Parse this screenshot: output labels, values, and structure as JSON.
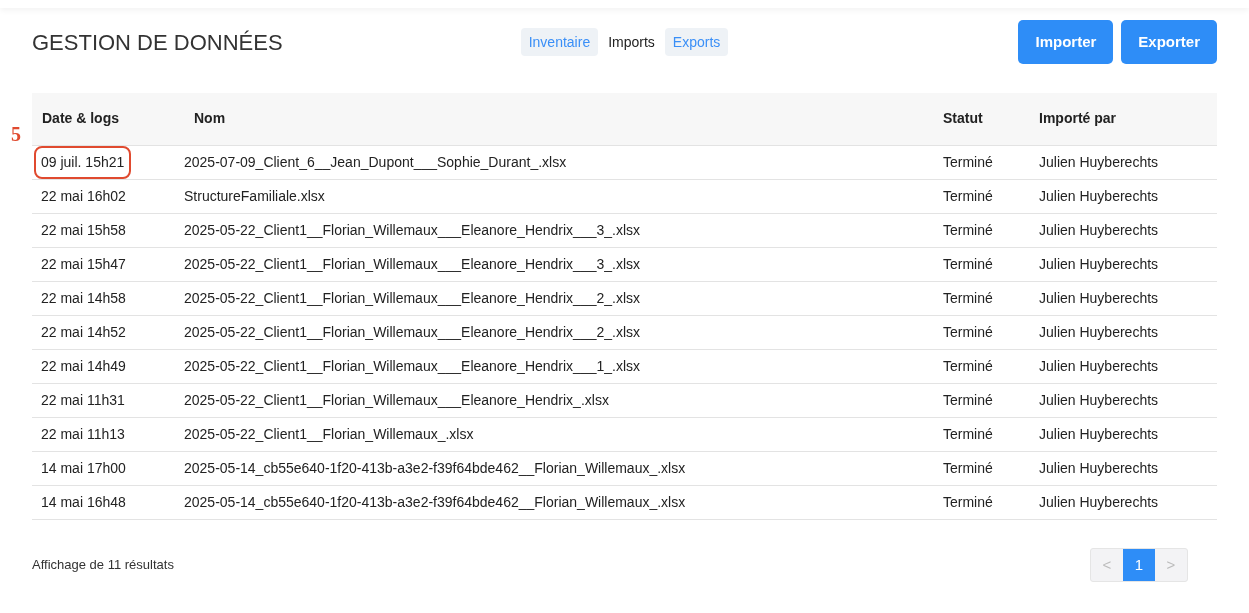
{
  "title": "GESTION DE DONNÉES",
  "tabs": [
    {
      "label": "Inventaire",
      "selected": false
    },
    {
      "label": "Imports",
      "selected": true
    },
    {
      "label": "Exports",
      "selected": false
    }
  ],
  "buttons": [
    "Importer",
    "Exporter"
  ],
  "annotation_label": "5",
  "table": {
    "columns": [
      "Date & logs",
      "Nom",
      "Statut",
      "Importé par"
    ],
    "rows": [
      {
        "date": "09 juil. 15h21",
        "name": "2025-07-09_Client_6__Jean_Dupont___Sophie_Durant_.xlsx",
        "status": "Terminé",
        "by": "Julien Huyberechts",
        "highlighted": true
      },
      {
        "date": "22 mai 16h02",
        "name": "StructureFamiliale.xlsx",
        "status": "Terminé",
        "by": "Julien Huyberechts",
        "highlighted": false
      },
      {
        "date": "22 mai 15h58",
        "name": "2025-05-22_Client1__Florian_Willemaux___Eleanore_Hendrix___3_.xlsx",
        "status": "Terminé",
        "by": "Julien Huyberechts",
        "highlighted": false
      },
      {
        "date": "22 mai 15h47",
        "name": "2025-05-22_Client1__Florian_Willemaux___Eleanore_Hendrix___3_.xlsx",
        "status": "Terminé",
        "by": "Julien Huyberechts",
        "highlighted": false
      },
      {
        "date": "22 mai 14h58",
        "name": "2025-05-22_Client1__Florian_Willemaux___Eleanore_Hendrix___2_.xlsx",
        "status": "Terminé",
        "by": "Julien Huyberechts",
        "highlighted": false
      },
      {
        "date": "22 mai 14h52",
        "name": "2025-05-22_Client1__Florian_Willemaux___Eleanore_Hendrix___2_.xlsx",
        "status": "Terminé",
        "by": "Julien Huyberechts",
        "highlighted": false
      },
      {
        "date": "22 mai 14h49",
        "name": "2025-05-22_Client1__Florian_Willemaux___Eleanore_Hendrix___1_.xlsx",
        "status": "Terminé",
        "by": "Julien Huyberechts",
        "highlighted": false
      },
      {
        "date": "22 mai 11h31",
        "name": "2025-05-22_Client1__Florian_Willemaux___Eleanore_Hendrix_.xlsx",
        "status": "Terminé",
        "by": "Julien Huyberechts",
        "highlighted": false
      },
      {
        "date": "22 mai 11h13",
        "name": "2025-05-22_Client1__Florian_Willemaux_.xlsx",
        "status": "Terminé",
        "by": "Julien Huyberechts",
        "highlighted": false
      },
      {
        "date": "14 mai 17h00",
        "name": "2025-05-14_cb55e640-1f20-413b-a3e2-f39f64bde462__Florian_Willemaux_.xlsx",
        "status": "Terminé",
        "by": "Julien Huyberechts",
        "highlighted": false
      },
      {
        "date": "14 mai 16h48",
        "name": "2025-05-14_cb55e640-1f20-413b-a3e2-f39f64bde462__Florian_Willemaux_.xlsx",
        "status": "Terminé",
        "by": "Julien Huyberechts",
        "highlighted": false
      }
    ]
  },
  "results": "Affichage de 11 résultats",
  "pagination": {
    "prev": "<",
    "next": ">",
    "pages": [
      {
        "label": "1",
        "selected": true
      }
    ]
  }
}
